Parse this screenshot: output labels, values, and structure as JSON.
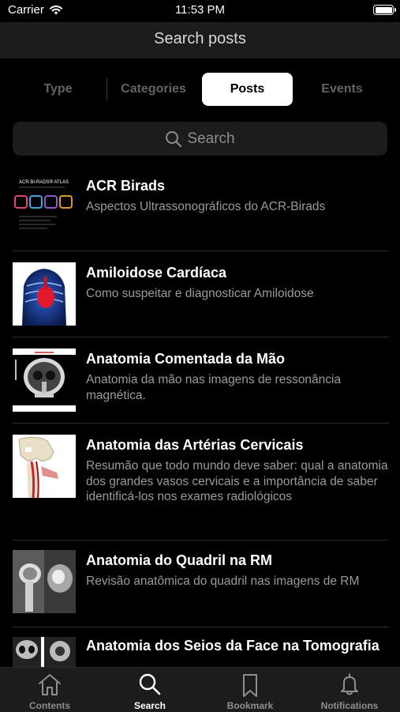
{
  "status_bar": {
    "carrier": "Carrier",
    "time": "11:53 PM"
  },
  "nav": {
    "title": "Search posts"
  },
  "segments": [
    {
      "label": "Type",
      "active": false
    },
    {
      "label": "Categories",
      "active": false
    },
    {
      "label": "Posts",
      "active": true
    },
    {
      "label": "Events",
      "active": false
    }
  ],
  "search": {
    "placeholder": "Search"
  },
  "posts": [
    {
      "title": "ACR Birads",
      "subtitle": "Aspectos Ultrassonográficos do ACR-Birads",
      "thumb_text": "ACR BI-RADS® ATLAS",
      "thumb": "book-cover"
    },
    {
      "title": "Amiloidose Cardíaca",
      "subtitle": "Como suspeitar e diagnosticar Amiloidose",
      "thumb": "chest-anatomy"
    },
    {
      "title": "Anatomia Comentada da Mão",
      "subtitle": "Anatomia da mão nas imagens de ressonância magnética.",
      "thumb": "ct-skull"
    },
    {
      "title": "Anatomia das Artérias Cervicais",
      "subtitle": "Resumão que todo mundo deve saber: qual a anatomia dos grandes vasos cervicais e a importância de saber identificá-los nos exames radiológicos",
      "thumb": "neck-vessels"
    },
    {
      "title": "Anatomia do Quadril na RM",
      "subtitle": "Revisão anatômica do quadril nas imagens de RM",
      "thumb": "hip-mri"
    },
    {
      "title": "Anatomia dos Seios da Face na Tomografia",
      "subtitle": "",
      "thumb": "sinus-ct"
    }
  ],
  "tabs": [
    {
      "label": "Contents",
      "icon": "house-icon",
      "active": false
    },
    {
      "label": "Search",
      "icon": "search-icon",
      "active": true
    },
    {
      "label": "Bookmark",
      "icon": "bookmark-icon",
      "active": false
    },
    {
      "label": "Notifications",
      "icon": "bell-icon",
      "active": false
    }
  ]
}
